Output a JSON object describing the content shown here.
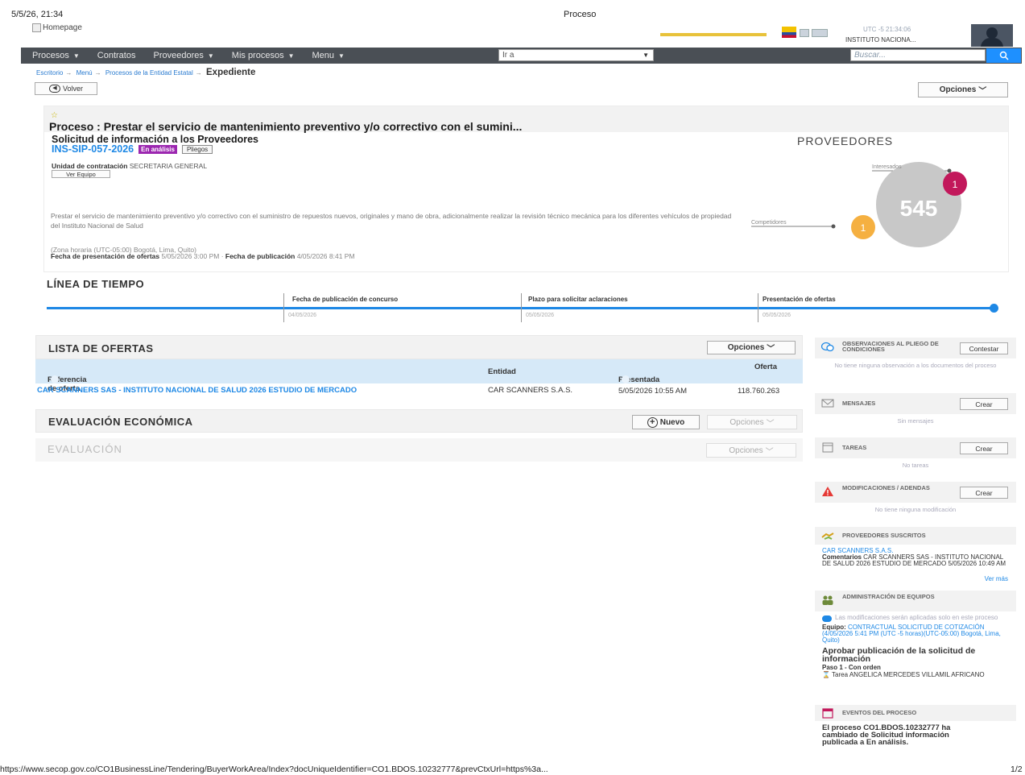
{
  "print": {
    "datetime": "5/5/26, 21:34",
    "title": "Proceso",
    "url": "https://www.secop.gov.co/CO1BusinessLine/Tendering/BuyerWorkArea/Index?docUniqueIdentifier=CO1.BDOS.10232777&prevCtxUrl=https%3a...",
    "page": "1/2"
  },
  "header": {
    "logo_alt": "Homepage",
    "utc": "UTC -5 21:34:06",
    "institution": "INSTITUTO NACIONA..."
  },
  "nav": {
    "items": [
      {
        "label": "Procesos",
        "caret": true
      },
      {
        "label": "Contratos",
        "caret": false
      },
      {
        "label": "Proveedores",
        "caret": true
      },
      {
        "label": "Mis procesos",
        "caret": true
      },
      {
        "label": "Menu",
        "caret": true
      }
    ],
    "goto_value": "Ir a",
    "search_placeholder": "Buscar..."
  },
  "breadcrumb": {
    "items": [
      "Escritorio",
      "Menú",
      "Procesos de la Entidad Estatal"
    ],
    "current": "Expediente"
  },
  "buttons": {
    "back": "Volver",
    "options": "Opciones",
    "ver_equipo": "Ver Equipo",
    "nuevo": "Nuevo",
    "contestar": "Contestar",
    "crear": "Crear"
  },
  "process": {
    "title": "Proceso : Prestar el servicio de mantenimiento preventivo y/o correctivo con el sumini...",
    "subtitle": "Solicitud de información a los Proveedores",
    "id": "INS-SIP-057-2026",
    "status_badge": "En análisis",
    "pliegos": "Pliegos",
    "unidad_label": "Unidad de contratación",
    "unidad_value": "SECRETARIA GENERAL",
    "description": "Prestar el servicio de mantenimiento preventivo y/o correctivo con el suministro de repuestos nuevos, originales y mano de obra, adicionalmente realizar la revisión técnico mecánica para los diferentes vehículos de propiedad del Instituto Nacional de Salud",
    "zone": "(Zona horaria (UTC-05:00) Bogotá, Lima, Quito)",
    "pres_label": "Fecha de presentación de ofertas",
    "pres_value": "5/05/2026 3:00 PM",
    "pub_label": "Fecha de publicación",
    "pub_value": "4/05/2026 8:41 PM"
  },
  "providers": {
    "title": "PROVEEDORES",
    "total": "545",
    "interesados_label": "Interesados",
    "interesados": "1",
    "competidores_label": "Competidores",
    "competidores": "1"
  },
  "timeline": {
    "title": "LÍNEA DE TIEMPO",
    "events": [
      {
        "label": "Fecha de publicación de concurso",
        "date": "04/05/2026"
      },
      {
        "label": "Plazo para solicitar aclaraciones",
        "date": "05/05/2026"
      },
      {
        "label": "Presentación de ofertas",
        "date": "05/05/2026"
      }
    ]
  },
  "offers": {
    "title": "LISTA DE OFERTAS",
    "columns": [
      "Referencia de oferta",
      "Entidad",
      "Presentada",
      "Oferta"
    ],
    "rows": [
      {
        "ref": "CAR SCANNERS SAS - INSTITUTO NACIONAL DE SALUD 2026 ESTUDIO DE MERCADO",
        "entity": "CAR SCANNERS S.A.S.",
        "presented": "5/05/2026 10:55 AM",
        "value": "118.760.263"
      }
    ]
  },
  "eval_econ": {
    "title": "EVALUACIÓN ECONÓMICA"
  },
  "eval": {
    "title": "EVALUACIÓN"
  },
  "sidebar": {
    "observaciones": {
      "title": "OBSERVACIONES AL PLIEGO DE CONDICIONES",
      "note": "No tiene ninguna observación a los documentos del proceso"
    },
    "mensajes": {
      "title": "MENSAJES",
      "note": "Sin mensajes"
    },
    "tareas": {
      "title": "TAREAS",
      "note": "No tareas"
    },
    "modificaciones": {
      "title": "MODIFICACIONES / ADENDAS",
      "note": "No tiene ninguna modificación"
    },
    "suscritos": {
      "title": "PROVEEDORES SUSCRITOS",
      "provider": "CAR SCANNERS S.A.S.",
      "comment_label": "Comentarios",
      "comment": "CAR SCANNERS SAS - INSTITUTO NACIONAL DE SALUD 2026 ESTUDIO DE MERCADO 5/05/2026 10:49 AM",
      "more": "Ver más"
    },
    "equipo": {
      "title": "ADMINISTRACIÓN DE EQUIPOS",
      "note": "Las modificaciones serán aplicadas solo en este proceso",
      "equipo_label": "Equipo:",
      "equipo_value": "CONTRACTUAL SOLICITUD DE COTIZACIÓN (4/05/2026 5:41 PM (UTC -5 horas)(UTC-05:00) Bogotá, Lima, Quito)",
      "aprobar": "Aprobar publicación de la solicitud de información",
      "paso": "Paso 1 - Con orden",
      "tarea": "Tarea ANGELICA MERCEDES VILLAMIL AFRICANO"
    },
    "eventos": {
      "title": "EVENTOS DEL PROCESO",
      "text": "El proceso CO1.BDOS.10232777 ha cambiado de Solicitud información publicada a En análisis."
    }
  },
  "colors": {
    "accent": "#1e88e5",
    "nav_bg": "#4a4f55",
    "badge": "#9c27b0",
    "interesados": "#c2185b",
    "competidores": "#f5b041"
  }
}
